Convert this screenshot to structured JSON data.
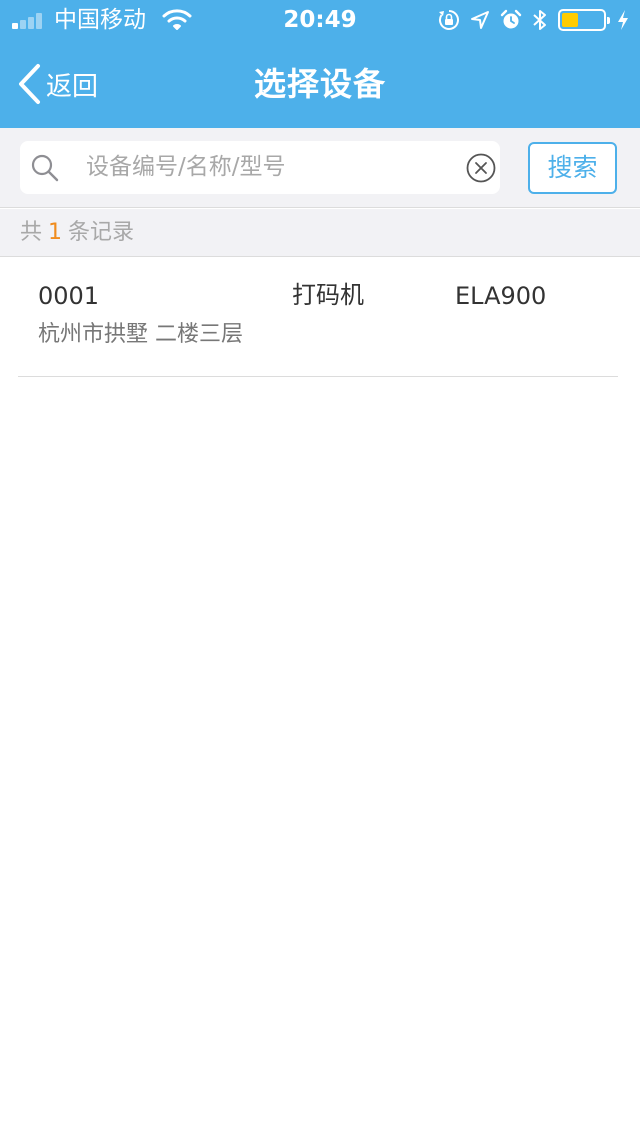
{
  "status_bar": {
    "carrier": "中国移动",
    "time": "20:49",
    "signal_bars_filled": 1,
    "battery_level": 0.4,
    "icons": [
      "orientation-lock-icon",
      "location-arrow-icon",
      "alarm-icon",
      "bluetooth-icon",
      "battery-icon",
      "charging-icon"
    ]
  },
  "nav": {
    "back_label": "返回",
    "title": "选择设备"
  },
  "search": {
    "placeholder": "设备编号/名称/型号",
    "value": "",
    "button_label": "搜索"
  },
  "record_count": {
    "prefix": "共",
    "count": "1",
    "suffix": "条记录"
  },
  "devices": [
    {
      "code": "0001",
      "name": "打码机",
      "model": "ELA900",
      "location": "杭州市拱墅  二楼三层"
    }
  ],
  "colors": {
    "header": "#4db0ea",
    "accent": "#4db0ea",
    "count_highlight": "#f08c1e",
    "battery": "#ffcc00"
  }
}
